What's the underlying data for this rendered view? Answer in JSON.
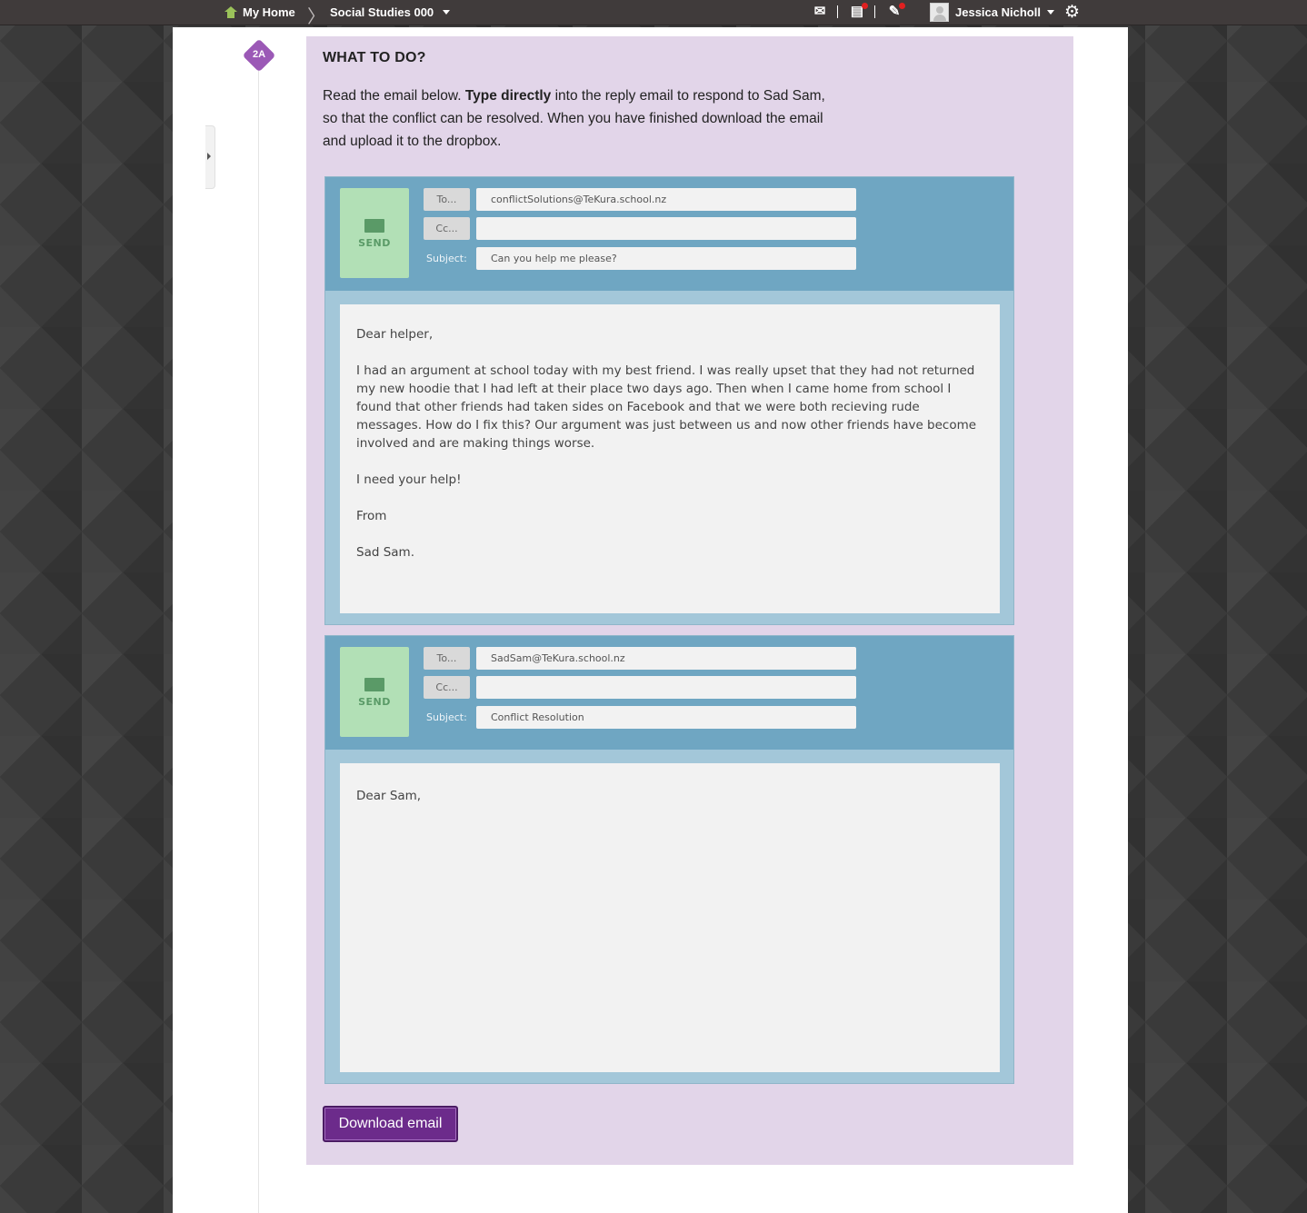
{
  "topbar": {
    "home_label": "My Home",
    "course_label": "Social Studies 000",
    "user_name": "Jessica Nicholl"
  },
  "activity": {
    "badge": "2A",
    "heading": "WHAT TO DO?",
    "instructions_pre": "Read the email below.",
    "instructions_bold": "Type directly",
    "instructions_post": "into the reply email to respond to Sad Sam, so that the conflict can be resolved. When you have finished download the email and upload it to the dropbox."
  },
  "email1": {
    "send_label": "SEND",
    "to_label": "To...",
    "cc_label": "Cc...",
    "subject_label": "Subject:",
    "to_value": "conflictSolutions@TeKura.school.nz",
    "cc_value": "",
    "subject_value": "Can you help me please?",
    "body": [
      "Dear helper,",
      "I had an argument at school today with my best friend. I was really upset that they had not returned my new hoodie that I had left at their place two days ago. Then when I came home from school I found that other friends had taken sides on Facebook and that we were both recieving rude messages. How do I fix this? Our argument was just between us and now other friends have become involved and are making things worse.",
      "I need your help!",
      "From",
      "Sad Sam."
    ]
  },
  "email2": {
    "send_label": "SEND",
    "to_label": "To...",
    "cc_label": "Cc...",
    "subject_label": "Subject:",
    "to_value": "SadSam@TeKura.school.nz",
    "cc_value": "",
    "subject_value": "Conflict Resolution",
    "body": "Dear Sam,"
  },
  "download_label": "Download email",
  "icons": [
    "home-icon",
    "chevron-right-icon",
    "caret-down-icon",
    "mail-icon",
    "notifications-icon",
    "feedback-icon",
    "avatar",
    "gear-icon",
    "envelope-icon"
  ],
  "colors": {
    "panel_bg": "#e2d5e9",
    "email_header": "#6fa6c2",
    "send_button": "#b2e0b6",
    "download_button": "#6c2b8b",
    "badge": "#9b59b6"
  }
}
